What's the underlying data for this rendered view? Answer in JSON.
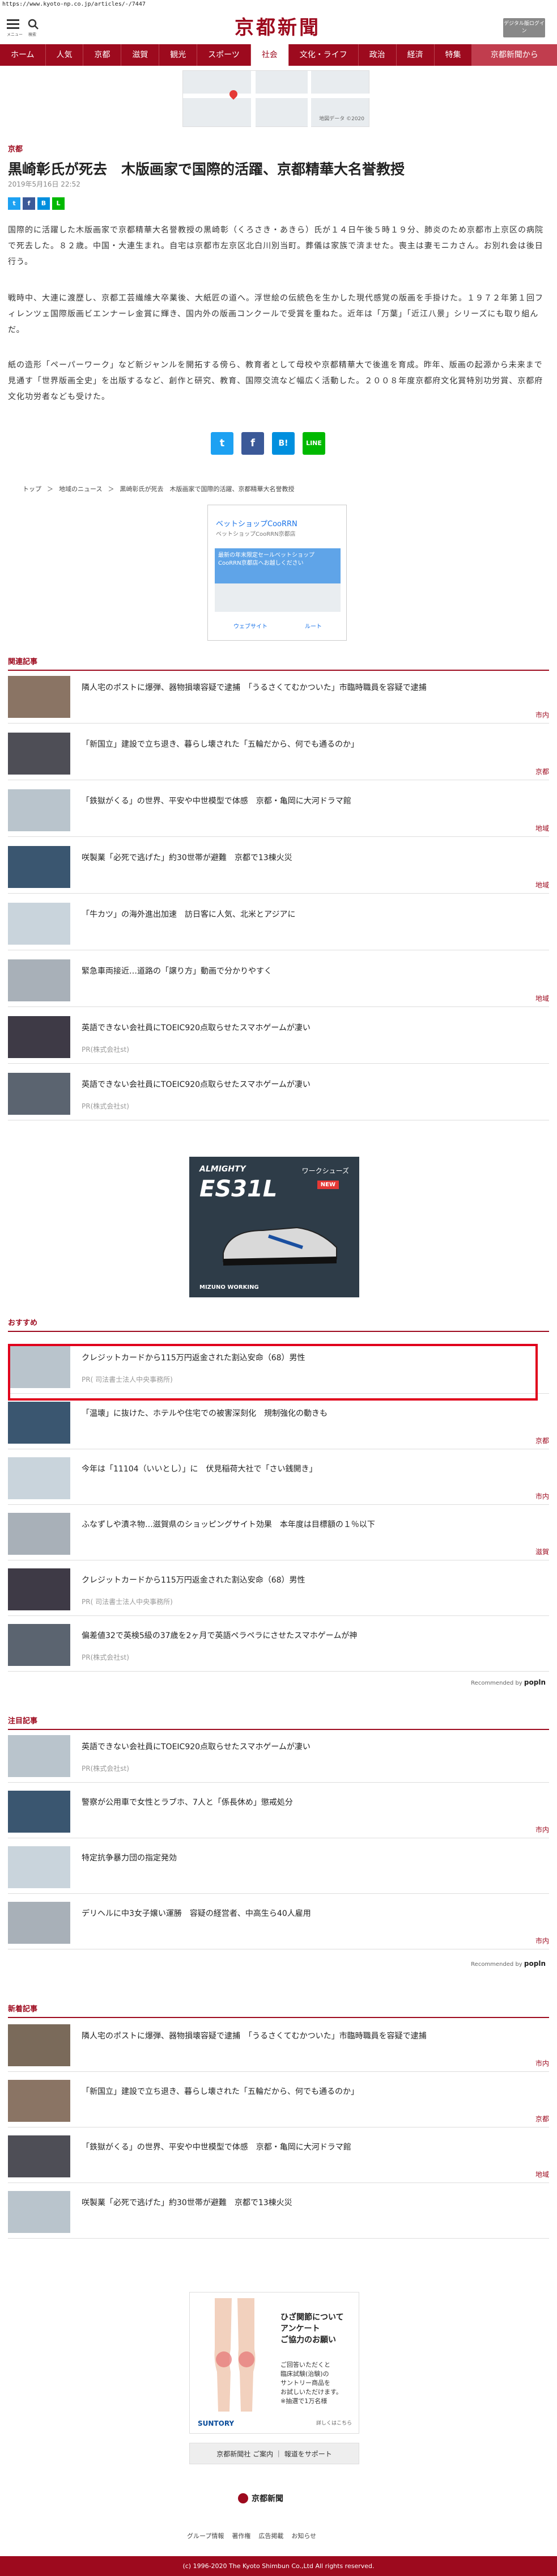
{
  "url": "https://www.kyoto-np.co.jp/articles/-/7447",
  "header": {
    "menu_label": "メニュー",
    "search_label": "検索",
    "logo": "京都新聞",
    "edition_button": "デジタル版ログイン"
  },
  "nav": [
    "ホーム",
    "人気",
    "京都",
    "滋賀",
    "観光",
    "スポーツ",
    "社会",
    "文化・ライフ",
    "政治",
    "経済",
    "特集",
    "京都新聞から"
  ],
  "map_ad_label": "地図データ ©2020",
  "article": {
    "section": "京都",
    "title": "黒崎彰氏が死去　木版画家で国際的活躍、京都精華大名誉教授",
    "date": "2019年5月16日 22:52",
    "para1": "国際的に活躍した木版画家で京都精華大名誉教授の黒崎彰（くろさき・あきら）氏が１４日午後５時１９分、肺炎のため京都市上京区の病院で死去した。８２歳。中国・大連生まれ。自宅は京都市左京区北白川別当町。葬儀は家族で済ませた。喪主は妻モニカさん。お別れ会は後日行う。",
    "para2": "戦時中、大連に渡歴し、京都工芸繊維大卒業後、大紙匠の道へ。浮世絵の伝統色を生かした現代感覚の版画を手掛けた。１９７２年第１回フィレンツェ国際版画ビエンナーレ金賞に輝き、国内外の版画コンクールで受賞を重ねた。近年は「万葉」「近江八景」シリーズにも取り組んだ。",
    "para3": "紙の造形「ペーパーワーク」など新ジャンルを開拓する傍ら、教育者として母校や京都精華大で後進を育成。昨年、版画の起源から未来まで見通す「世界版画全史」を出版するなど、創作と研究、教育、国際交流など幅広く活動した。２００８年度京都府文化賞特別功労賞、京都府文化功労者なども受けた。"
  },
  "share_big": [
    "t",
    "f",
    "B!",
    "LINE"
  ],
  "breadcrumb": [
    "トップ",
    "＞",
    "地域のニュース",
    "＞",
    "黒崎彰氏が死去　木版画家で国際的活躍、京都精華大名誉教授"
  ],
  "square_ad": {
    "t1": "ベットショップCooRRN",
    "t2": "ベットショップCooRRN京都店",
    "blue": "最新の年末限定セールベットショップCooRRN京都店へお越しください",
    "action_left": "ウェブサイト",
    "action_right": "ルート"
  },
  "related": {
    "heading": "関連記事",
    "items": [
      {
        "title": "隣人宅のポストに爆弾、器物損壊容疑で逮捕　「うるさくてむかついた」市臨時職員を容疑で逮捕",
        "tag": "市内",
        "pr": ""
      },
      {
        "title": "「新国立」建設で立ち退き、暮らし壊された「五輪だから、何でも通るのか」",
        "tag": "京都",
        "pr": ""
      },
      {
        "title": "「鉄獄がくる」の世界、平安や中世模型で体感　京都・亀岡に大河ドラマ館",
        "tag": "地域",
        "pr": ""
      },
      {
        "title": "咲製業「必死で逃げた」約30世帯が避難　京都で13棟火災",
        "tag": "地域",
        "pr": ""
      },
      {
        "title": "「牛カツ」の海外進出加速　訪日客に人気、北米とアジアに",
        "tag": "",
        "pr": ""
      },
      {
        "title": "緊急車両接近…道路の「譲り方」動画で分かりやすく",
        "tag": "地域",
        "pr": ""
      },
      {
        "title": "英語できない会社員にTOEIC920点取らせたスマホゲームが凄い",
        "tag": "",
        "pr": "PR(株式会社st)"
      },
      {
        "title": "英語できない会社員にTOEIC920点取らせたスマホゲームが凄い",
        "tag": "",
        "pr": "PR(株式会社st)"
      }
    ]
  },
  "shoe_ad": {
    "b1": "ALMIGHTY",
    "b2": "ES31L",
    "jp": "ワークシューズ",
    "new": "NEW",
    "foot": "MIZUNO WORKING"
  },
  "recommend": {
    "heading": "おすすめ",
    "items": [
      {
        "title": "クレジットカードから115万円返金された割込安命（68）男性",
        "tag": "",
        "pr": "PR( 司法書士法人中央事務所)"
      },
      {
        "title": "「温壊」に抜けた、ホテルや住宅での被害深刻化　規制強化の動きも",
        "tag": "京都",
        "pr": ""
      },
      {
        "title": "今年は「11104（いいとし）」に　伏見稲荷大社で「さい銭開き」",
        "tag": "市内",
        "pr": ""
      },
      {
        "title": "ふなずしや漬ネ物…滋賀県のショッピングサイト効果　本年度は目標額の１％以下",
        "tag": "滋賀",
        "pr": ""
      },
      {
        "title": "クレジットカードから115万円返金された割込安命（68）男性",
        "tag": "",
        "pr": "PR( 司法書士法人中央事務所)"
      },
      {
        "title": "偏差値32で英検5級の37歳を2ヶ月で英語ペラペラにさせたスマホゲームが神",
        "tag": "",
        "pr": "PR(株式会社st)"
      }
    ],
    "by": "Recommended by",
    "by_brand": "popln"
  },
  "attention": {
    "heading": "注目記事",
    "items": [
      {
        "title": "英語できない会社員にTOEIC920点取らせたスマホゲームが凄い",
        "tag": "",
        "pr": "PR(株式会社st)"
      },
      {
        "title": "警察が公用車で女性とラブホ、7人と「係長休め」懲戒処分",
        "tag": "市内",
        "pr": ""
      },
      {
        "title": "特定抗争暴力団の指定発効",
        "tag": "",
        "pr": ""
      },
      {
        "title": "デリヘルに中3女子嬢い運勝　容疑の経営者、中高生ら40人雇用",
        "tag": "市内",
        "pr": ""
      }
    ],
    "by": "Recommended by",
    "by_brand": "popln"
  },
  "latest": {
    "heading": "新着記事",
    "items": [
      {
        "title": "隣人宅のポストに爆弾、器物損壊容疑で逮捕　「うるさくてむかついた」市臨時職員を容疑で逮捕",
        "tag": "市内",
        "pr": ""
      },
      {
        "title": "「新国立」建設で立ち退き、暮らし壊された「五輪だから、何でも通るのか」",
        "tag": "京都",
        "pr": ""
      },
      {
        "title": "「鉄獄がくる」の世界、平安や中世模型で体感　京都・亀岡に大河ドラマ館",
        "tag": "地域",
        "pr": ""
      },
      {
        "title": "咲製業「必死で逃げた」約30世帯が避難　京都で13棟火災",
        "tag": "",
        "pr": ""
      }
    ]
  },
  "health_ad": {
    "h1": "ひざ関節について\nアンケート\nご協力のお願い",
    "h2": "ご回答いただくと\n臨床試験(治験)の\nサントリー商品を\nお試しいただけます。\n※抽選で1万名様",
    "brand": "SUNTORY",
    "note": "詳しくはこちら"
  },
  "footer": {
    "btn": "京都新聞社 ご案内 ｜ 報道をサポート",
    "logo": "京都新聞",
    "links": [
      "グループ情報",
      "著作権",
      "広告掲載",
      "お知らせ"
    ],
    "copyright": "(c) 1996-2020 The Kyoto Shimbun Co.,Ltd All rights reserved."
  },
  "colors": {
    "brand": "#9d0a1e",
    "highlight": "#e0001b"
  }
}
